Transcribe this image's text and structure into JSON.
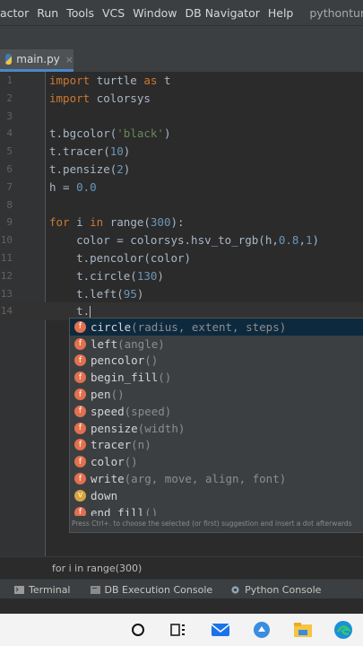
{
  "menubar": {
    "items": [
      "actor",
      "Run",
      "Tools",
      "VCS",
      "Window",
      "DB Navigator",
      "Help"
    ],
    "project": "pythonturtleproje"
  },
  "tab": {
    "label": "main.py",
    "close": "×"
  },
  "code": [
    {
      "n": "1",
      "tokens": [
        {
          "t": "import",
          "c": "kw"
        },
        {
          "t": " turtle ",
          "c": ""
        },
        {
          "t": "as",
          "c": "kw"
        },
        {
          "t": " t",
          "c": ""
        }
      ]
    },
    {
      "n": "2",
      "tokens": [
        {
          "t": "import",
          "c": "kw"
        },
        {
          "t": " colorsys",
          "c": ""
        }
      ]
    },
    {
      "n": "3",
      "tokens": []
    },
    {
      "n": "4",
      "tokens": [
        {
          "t": "t.bgcolor(",
          "c": ""
        },
        {
          "t": "'black'",
          "c": "str"
        },
        {
          "t": ")",
          "c": ""
        }
      ]
    },
    {
      "n": "5",
      "tokens": [
        {
          "t": "t.tracer(",
          "c": ""
        },
        {
          "t": "10",
          "c": "numc"
        },
        {
          "t": ")",
          "c": ""
        }
      ]
    },
    {
      "n": "6",
      "tokens": [
        {
          "t": "t.pensize(",
          "c": ""
        },
        {
          "t": "2",
          "c": "numc"
        },
        {
          "t": ")",
          "c": ""
        }
      ]
    },
    {
      "n": "7",
      "tokens": [
        {
          "t": "h = ",
          "c": ""
        },
        {
          "t": "0.0",
          "c": "numc"
        }
      ]
    },
    {
      "n": "8",
      "tokens": []
    },
    {
      "n": "9",
      "tokens": [
        {
          "t": "for",
          "c": "kw"
        },
        {
          "t": " i ",
          "c": ""
        },
        {
          "t": "in",
          "c": "kw"
        },
        {
          "t": " range(",
          "c": ""
        },
        {
          "t": "300",
          "c": "numc"
        },
        {
          "t": "):",
          "c": ""
        }
      ]
    },
    {
      "n": "10",
      "tokens": [
        {
          "t": "    color = colorsys.hsv_to_rgb(h,",
          "c": ""
        },
        {
          "t": "0.8",
          "c": "numc"
        },
        {
          "t": ",",
          "c": ""
        },
        {
          "t": "1",
          "c": "numc"
        },
        {
          "t": ")",
          "c": ""
        }
      ]
    },
    {
      "n": "11",
      "tokens": [
        {
          "t": "    t.pencolor(color)",
          "c": ""
        }
      ]
    },
    {
      "n": "12",
      "tokens": [
        {
          "t": "    t.circle(",
          "c": ""
        },
        {
          "t": "130",
          "c": "numc"
        },
        {
          "t": ")",
          "c": ""
        }
      ]
    },
    {
      "n": "13",
      "tokens": [
        {
          "t": "    t.left(",
          "c": ""
        },
        {
          "t": "95",
          "c": "numc"
        },
        {
          "t": ")",
          "c": ""
        }
      ]
    },
    {
      "n": "14",
      "tokens": [
        {
          "t": "    t.",
          "c": ""
        }
      ],
      "current": true
    }
  ],
  "completion": {
    "items": [
      {
        "badge": "f",
        "name": "circle",
        "sig": "(radius, extent, steps)",
        "selected": true
      },
      {
        "badge": "f",
        "name": "left",
        "sig": "(angle)"
      },
      {
        "badge": "f",
        "name": "pencolor",
        "sig": "()"
      },
      {
        "badge": "f",
        "name": "begin_fill",
        "sig": "()"
      },
      {
        "badge": "f",
        "name": "pen",
        "sig": "()"
      },
      {
        "badge": "f",
        "name": "speed",
        "sig": "(speed)"
      },
      {
        "badge": "f",
        "name": "pensize",
        "sig": "(width)"
      },
      {
        "badge": "f",
        "name": "tracer",
        "sig": "(n)"
      },
      {
        "badge": "f",
        "name": "color",
        "sig": "()"
      },
      {
        "badge": "f",
        "name": "write",
        "sig": "(arg, move, align, font)"
      },
      {
        "badge": "v",
        "name": "down",
        "sig": ""
      },
      {
        "badge": "f",
        "name": "end_fill",
        "sig": "()"
      }
    ],
    "hint": "Press Ctrl+. to choose the selected (or first) suggestion and insert a dot afterwards"
  },
  "breadcrumb": "for i in range(300)",
  "tool_windows": [
    {
      "label": "Terminal",
      "icon": "terminal-icon"
    },
    {
      "label": "DB Execution Console",
      "icon": "db-console-icon"
    },
    {
      "label": "Python Console",
      "icon": "python-console-icon"
    }
  ],
  "taskbar": {
    "icons": [
      "cortana-circle-icon",
      "task-view-icon",
      "mail-icon",
      "settings-app-icon",
      "file-explorer-icon",
      "edge-icon"
    ]
  },
  "colors": {
    "editor_bg": "#2b2b2b",
    "keyword": "#cc7832",
    "string": "#6a8759",
    "number": "#6897bb",
    "function_badge": "#e2704f",
    "variable_badge": "#d9a440",
    "selection": "#0d293e"
  }
}
